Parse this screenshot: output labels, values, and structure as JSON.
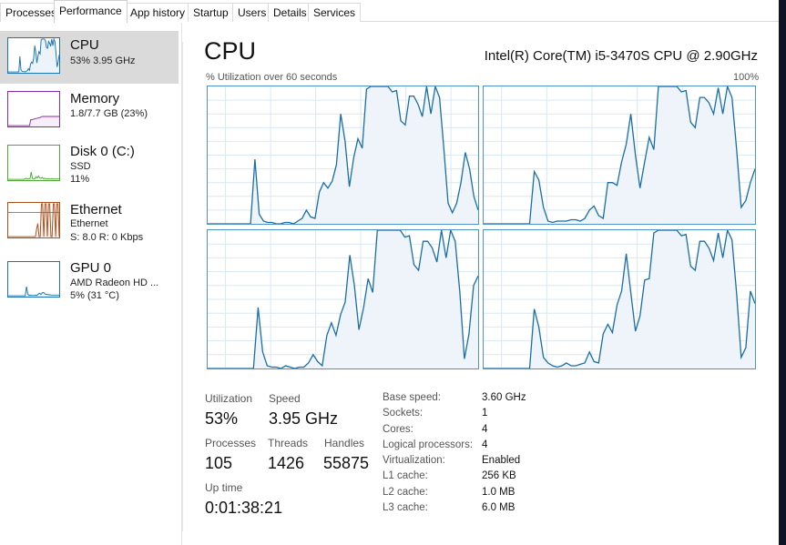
{
  "tabs": [
    {
      "label": "Processes",
      "active": false
    },
    {
      "label": "Performance",
      "active": true
    },
    {
      "label": "App history",
      "active": false
    },
    {
      "label": "Startup",
      "active": false
    },
    {
      "label": "Users",
      "active": false
    },
    {
      "label": "Details",
      "active": false
    },
    {
      "label": "Services",
      "active": false
    }
  ],
  "sidebar": {
    "items": [
      {
        "title": "CPU",
        "line1": "53% 3.95 GHz",
        "line2": "",
        "color": "#1a74b4",
        "selected": true
      },
      {
        "title": "Memory",
        "line1": "1.8/7.7 GB (23%)",
        "line2": "",
        "color": "#8b2ba6",
        "selected": false
      },
      {
        "title": "Disk 0 (C:)",
        "line1": "SSD",
        "line2": "11%",
        "color": "#4da834",
        "selected": false
      },
      {
        "title": "Ethernet",
        "line1": "Ethernet",
        "line2": "S: 8.0 R: 0 Kbps",
        "color": "#a8501e",
        "selected": false
      },
      {
        "title": "GPU 0",
        "line1": "AMD Radeon HD ...",
        "line2": "5% (31 °C)",
        "color": "#1a74b4",
        "selected": false
      }
    ]
  },
  "main": {
    "title": "CPU",
    "model": "Intel(R) Core(TM) i5-3470S CPU @ 2.90GHz",
    "graph_caption": "% Utilization over 60 seconds",
    "graph_max": "100%",
    "line_color": "#1a6ea8",
    "fill_color": "#eef4fa",
    "grid_color": "#d9e8f3",
    "cores": [
      {
        "name": "core-0",
        "values": [
          0,
          0,
          0,
          0,
          0,
          0,
          0,
          0,
          0,
          0,
          0,
          47,
          7,
          2,
          1,
          1,
          0,
          0,
          1,
          1,
          0,
          2,
          4,
          10,
          5,
          4,
          23,
          30,
          26,
          31,
          43,
          80,
          60,
          27,
          48,
          62,
          55,
          98,
          100,
          100,
          100,
          100,
          100,
          96,
          97,
          75,
          72,
          93,
          93,
          87,
          78,
          100,
          80,
          100,
          92,
          55,
          15,
          8,
          15,
          30,
          52,
          40,
          20,
          10
        ]
      },
      {
        "name": "core-1",
        "values": [
          0,
          0,
          0,
          0,
          0,
          0,
          0,
          0,
          0,
          0,
          0,
          38,
          32,
          12,
          2,
          1,
          2,
          2,
          2,
          3,
          3,
          2,
          4,
          10,
          13,
          6,
          4,
          30,
          30,
          28,
          45,
          58,
          80,
          50,
          26,
          45,
          63,
          54,
          100,
          100,
          100,
          100,
          100,
          96,
          97,
          74,
          70,
          92,
          92,
          88,
          80,
          99,
          80,
          100,
          92,
          54,
          12,
          17,
          30,
          40
        ]
      },
      {
        "name": "core-2",
        "values": [
          0,
          0,
          0,
          0,
          0,
          0,
          0,
          0,
          0,
          0,
          0,
          44,
          12,
          2,
          1,
          1,
          0,
          2,
          1,
          0,
          1,
          1,
          4,
          10,
          5,
          2,
          24,
          33,
          24,
          39,
          48,
          82,
          60,
          28,
          44,
          65,
          55,
          100,
          100,
          100,
          100,
          100,
          100,
          95,
          96,
          75,
          71,
          92,
          92,
          87,
          77,
          100,
          80,
          100,
          92,
          55,
          7,
          25,
          60,
          67
        ]
      },
      {
        "name": "core-3",
        "values": [
          0,
          0,
          0,
          0,
          0,
          0,
          0,
          0,
          0,
          0,
          0,
          43,
          30,
          8,
          4,
          2,
          1,
          2,
          4,
          2,
          2,
          3,
          4,
          12,
          5,
          4,
          25,
          32,
          26,
          46,
          56,
          83,
          55,
          27,
          38,
          64,
          65,
          98,
          100,
          100,
          100,
          100,
          100,
          96,
          97,
          74,
          71,
          92,
          92,
          87,
          78,
          98,
          80,
          100,
          93,
          54,
          8,
          15,
          56,
          47
        ]
      }
    ]
  },
  "stats": {
    "utilization_label": "Utilization",
    "utilization": "53%",
    "speed_label": "Speed",
    "speed": "3.95 GHz",
    "processes_label": "Processes",
    "processes": "105",
    "threads_label": "Threads",
    "threads": "1426",
    "handles_label": "Handles",
    "handles": "55875",
    "uptime_label": "Up time",
    "uptime": "0:01:38:21"
  },
  "specs": [
    {
      "key": "Base speed:",
      "value": "3.60 GHz"
    },
    {
      "key": "Sockets:",
      "value": "1"
    },
    {
      "key": "Cores:",
      "value": "4"
    },
    {
      "key": "Logical processors:",
      "value": "4"
    },
    {
      "key": "Virtualization:",
      "value": "Enabled"
    },
    {
      "key": "L1 cache:",
      "value": "256 KB"
    },
    {
      "key": "L2 cache:",
      "value": "1.0 MB"
    },
    {
      "key": "L3 cache:",
      "value": "6.0 MB"
    }
  ],
  "sidebar_sparks": {
    "cpu": [
      0,
      0,
      0,
      0,
      0,
      0,
      0,
      0,
      0,
      0,
      0,
      47,
      7,
      2,
      1,
      1,
      0,
      2,
      4,
      10,
      5,
      24,
      30,
      26,
      43,
      80,
      60,
      27,
      48,
      62,
      55,
      98,
      100,
      100,
      100,
      96,
      75,
      72,
      93,
      87,
      78,
      100,
      80,
      100,
      92,
      55,
      15,
      30,
      52
    ],
    "memory": [
      0,
      0,
      0,
      0,
      0,
      0,
      0,
      0,
      0,
      0,
      0,
      0,
      0,
      0,
      0,
      0,
      0,
      0,
      0,
      18,
      18,
      19,
      20,
      21,
      22,
      23,
      24,
      25,
      27,
      28,
      28,
      28,
      28,
      28,
      28,
      28,
      28,
      28,
      28,
      28,
      28,
      28,
      28,
      28
    ],
    "disk": [
      0,
      0,
      0,
      0,
      0,
      0,
      0,
      0,
      0,
      0,
      0,
      0,
      0,
      0,
      2,
      3,
      1,
      2,
      2,
      22,
      2,
      1,
      2,
      8,
      4,
      10,
      4,
      3,
      6,
      2,
      3,
      2,
      1,
      2,
      1,
      1,
      2,
      1,
      1,
      1,
      1,
      1,
      1
    ],
    "ethernet": [
      0,
      0,
      0,
      0,
      0,
      0,
      0,
      0,
      0,
      0,
      0,
      0,
      0,
      0,
      0,
      0,
      0,
      0,
      0,
      0,
      0,
      0,
      0,
      0,
      25,
      40,
      0,
      0,
      100,
      100,
      0,
      100,
      100,
      0,
      100,
      100,
      0,
      0,
      100,
      100,
      0,
      100,
      100,
      0
    ],
    "gpu": [
      0,
      0,
      0,
      0,
      0,
      0,
      0,
      0,
      0,
      0,
      0,
      0,
      0,
      0,
      28,
      5,
      1,
      2,
      1,
      1,
      1,
      2,
      1,
      5,
      8,
      4,
      9,
      10,
      6,
      4,
      4,
      3,
      3,
      2,
      2,
      2,
      2,
      2,
      2,
      2
    ]
  }
}
